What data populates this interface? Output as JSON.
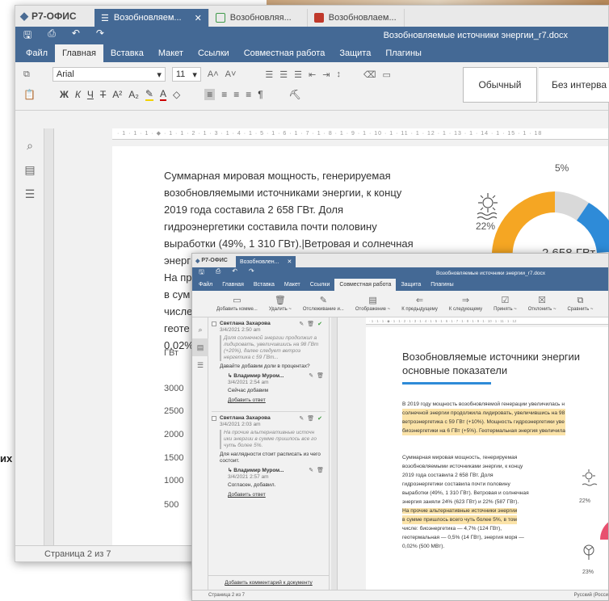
{
  "background": {
    "fragment_text": "их"
  },
  "window_main": {
    "app_name": "Р7-ОФИС",
    "tabs": [
      {
        "label": "Возобновляем...",
        "color": "#446995",
        "active": true
      },
      {
        "label": "Возобновляя...",
        "color": "#3f9a4a",
        "active": false
      },
      {
        "label": "Возобновлаем...",
        "color": "#c0392b",
        "active": false
      }
    ],
    "document_title": "Возобновляемые источники энергии_r7.docx",
    "menu": [
      "Файл",
      "Главная",
      "Вставка",
      "Макет",
      "Ссылки",
      "Совместная работа",
      "Защита",
      "Плагины"
    ],
    "active_menu": "Главная",
    "font_name": "Arial",
    "font_size": "11",
    "styles": [
      "Обычный",
      "Без интерва"
    ],
    "paragraph_lines": [
      "Суммарная мировая мощность, генерируемая",
      "возобновляемыми источниками энергии, к концу",
      "2019 года составила 2 658 ГВт.  Доля",
      "гидроэнергетики составила почти половину",
      "выработки (49%, 1 310 ГВт).|Ветровая и солнечная",
      "энерг",
      "На пр",
      "в сум",
      "числе",
      "геоте",
      "0,02%"
    ],
    "axis_unit": "ГВт",
    "axis_ticks": [
      "3000",
      "2500",
      "2000",
      "1500",
      "1000",
      "500"
    ],
    "donut": {
      "label_top": "5%",
      "label_left": "22%",
      "center_text": "2 658 ГВт"
    },
    "status": "Страница 2 из 7"
  },
  "window_comments": {
    "app_name": "Р7-ОФИС",
    "tab_label": "Возобновлен...",
    "document_title": "Возобновляемые источники энергии_r7.docx",
    "menu": [
      "Файл",
      "Главная",
      "Вставка",
      "Макет",
      "Ссылки",
      "Совместная работа",
      "Защита",
      "Плагины"
    ],
    "active_menu": "Совместная работа",
    "toolbar": [
      "Добавить комме...",
      "Удалить ~",
      "Отслеживание и...",
      "Отображение ~",
      "К предыдущему",
      "К следующему",
      "Принять ~",
      "Отклонить ~",
      "Сравнить ~"
    ],
    "comments": [
      {
        "author": "Светлана Захарова",
        "date": "3/4/2021 2:50 am",
        "quote": "Доля солнечной энергии продолжил а лидировать, увеличившись на 98 ГВт (+20%), далее следует ветроэ нергетика с 59 ГВт...",
        "text": "Давайте добавим доли в процентах?",
        "reply_author": "Владимир Муром...",
        "reply_date": "3/4/2021 2:54 am",
        "reply_text": "Сейчас добавим",
        "reply_link": "Добавить ответ"
      },
      {
        "author": "Светлана Захарова",
        "date": "3/4/2021 2:03 am",
        "quote": "На прочие альтернативные источн ики энергии в сумме пришлось все го чуть более 5%.",
        "text": "Для наглядности стоит расписать из чего состоит.",
        "reply_author": "Владимир Муром...",
        "reply_date": "3/4/2021 2:57 am",
        "reply_text": "Согласен, добавил.",
        "reply_link": "Добавить ответ"
      }
    ],
    "add_doc_comment": "Добавить комментарий к документу",
    "heading_lines": [
      "Возобновляемые источники энергии",
      "основные показатели"
    ],
    "para1_lines": [
      "В 2019 году мощность возобновляемой генерации увеличилась н",
      "солнечной энергии продолжила лидировать, увеличившись на 98",
      "ветроэнергетика с 59 ГВт (+10%). Мощность гидроэнергетики уве",
      "биоэнергетики на 6 ГВт (+5%). Геотермальная энергия увеличила"
    ],
    "para2_lines": [
      "Суммарная мировая мощность, генерируемая",
      "возобновляемыми источниками энергии, к концу",
      "2019 года составила 2 658 ГВт.  Доля",
      "гидроэнергетики составила почти половину",
      "выработки (49%, 1 310 ГВт). Ветровая и солнечная",
      "энергия заняли 24% (623 ГВт) и 22% (587 ГВт).",
      "На прочие альтернативные источники энергии",
      "в сумме пришлось всего чуть более 5%, в том",
      "числе: биоэнергетика — 4,7% (124 ГВт),",
      "геотермальная — 0,5% (14 ГВт), энергия моря —",
      "0,02% (500 МВт)."
    ],
    "chart_labels": [
      "22%",
      "23%"
    ],
    "status": "Страница 2 из 7",
    "language": "Русский (Росси"
  }
}
